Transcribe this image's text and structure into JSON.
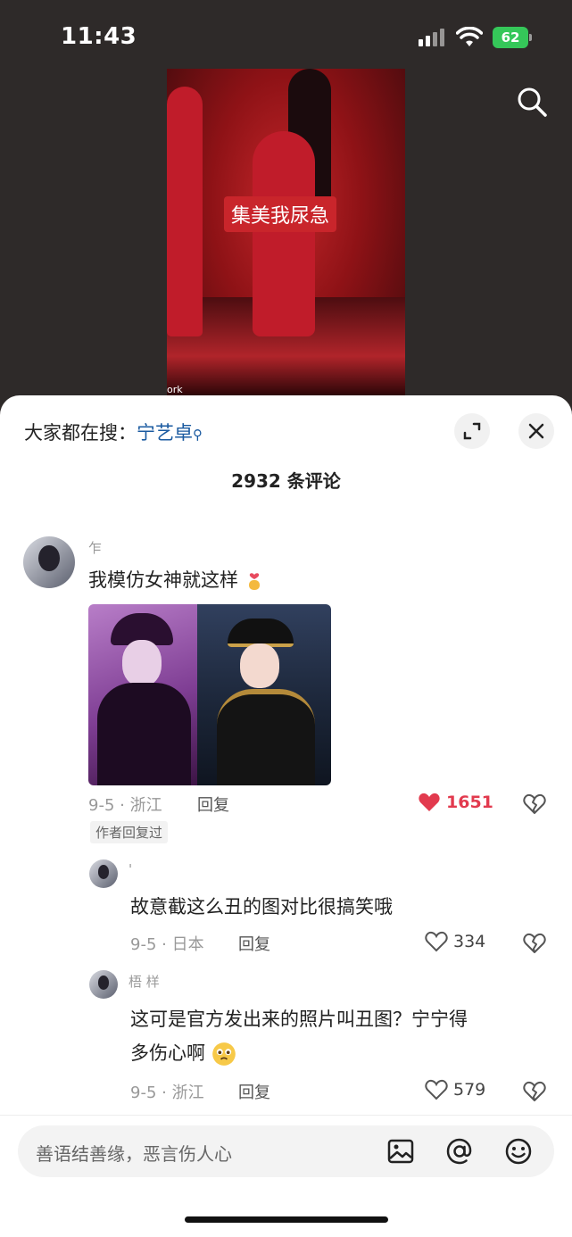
{
  "status": {
    "time": "11:43",
    "battery": "62"
  },
  "video": {
    "caption": "集美我尿急",
    "watermark": "ork"
  },
  "sheet": {
    "hot_search_label": "大家都在搜：",
    "hot_search_keyword": "宁艺卓",
    "comment_count": "2932 条评论"
  },
  "comments": [
    {
      "username": "乍",
      "text": "我模仿女神就这样",
      "date_location": "9-5 · 浙江",
      "reply": "回复",
      "likes": "1651",
      "liked": true,
      "badge": "作者回复过"
    },
    {
      "username": "'",
      "text": "故意截这么丑的图对比很搞笑哦",
      "date_location": "9-5 · 日本",
      "reply": "回复",
      "likes": "334"
    },
    {
      "username": "梧 样",
      "text_line1": "这可是官方发出来的照片叫丑图？宁宁得",
      "text_line2": "多伤心啊",
      "date_location": "9-5 · 浙江",
      "reply": "回复",
      "likes": "579"
    }
  ],
  "input": {
    "placeholder": "善语结善缘，恶言伤人心"
  },
  "icons": [
    "search-icon",
    "expand-icon",
    "close-icon",
    "heart-icon",
    "dislike-icon",
    "image-icon",
    "at-icon",
    "emoji-icon"
  ],
  "colors": {
    "liked": "#e23a4e",
    "keyword": "#1a5aa0",
    "battery": "#35c759"
  }
}
